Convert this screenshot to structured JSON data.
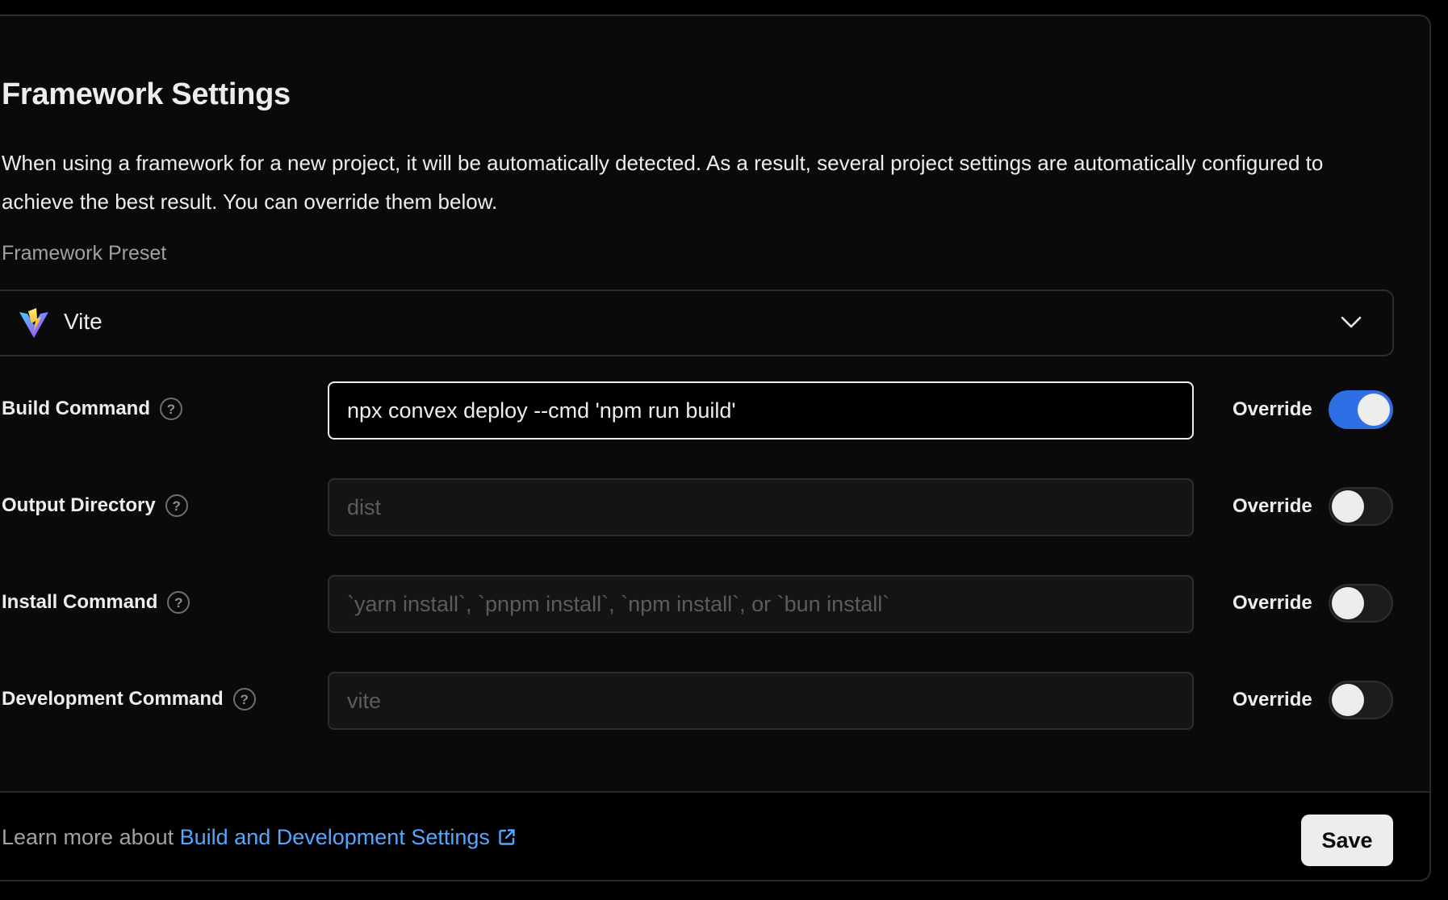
{
  "section": {
    "title": "Framework Settings",
    "description": "When using a framework for a new project, it will be automatically detected. As a result, several project settings are automatically configured to achieve the best result. You can override them below."
  },
  "preset": {
    "label": "Framework Preset",
    "value": "Vite",
    "icon": "vite-logo-icon"
  },
  "settings": [
    {
      "label": "Build Command",
      "value": "npx convex deploy --cmd 'npm run build'",
      "placeholder": "",
      "override_label": "Override",
      "override_on": true
    },
    {
      "label": "Output Directory",
      "value": "",
      "placeholder": "dist",
      "override_label": "Override",
      "override_on": false
    },
    {
      "label": "Install Command",
      "value": "",
      "placeholder": "`yarn install`, `pnpm install`, `npm install`, or `bun install`",
      "override_label": "Override",
      "override_on": false
    },
    {
      "label": "Development Command",
      "value": "",
      "placeholder": "vite",
      "override_label": "Override",
      "override_on": false
    }
  ],
  "help_icon_glyph": "?",
  "footer": {
    "text": "Learn more about ",
    "link_text": "Build and Development Settings",
    "save_label": "Save"
  },
  "colors": {
    "accent": "#2f6fe6",
    "link": "#52a8ff",
    "background": "#0a0a0a"
  }
}
